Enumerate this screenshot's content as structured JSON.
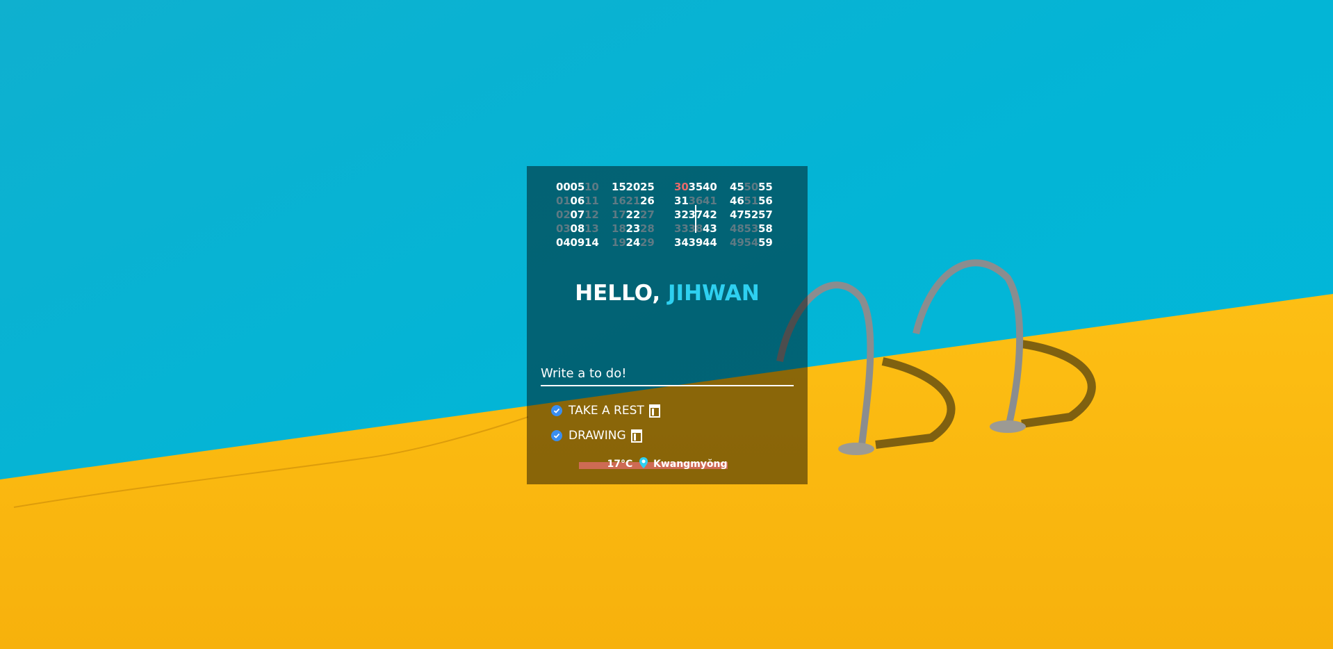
{
  "clock": {
    "columns": [
      [
        "00",
        "01",
        "02",
        "03",
        "04"
      ],
      [
        "05",
        "06",
        "07",
        "08",
        "09"
      ],
      [
        "10",
        "11",
        "12",
        "13",
        "14"
      ],
      [
        "15",
        "16",
        "17",
        "18",
        "19"
      ],
      [
        "20",
        "21",
        "22",
        "23",
        "24"
      ],
      [
        "25",
        "26",
        "27",
        "28",
        "29"
      ],
      [
        "30",
        "31",
        "32",
        "33",
        "34"
      ],
      [
        "35",
        "36",
        "37",
        "38",
        "39"
      ],
      [
        "40",
        "41",
        "42",
        "43",
        "44"
      ],
      [
        "45",
        "46",
        "47",
        "48",
        "49"
      ],
      [
        "50",
        "51",
        "52",
        "53",
        "54"
      ],
      [
        "55",
        "56",
        "57",
        "58",
        "59"
      ]
    ],
    "highlighted_current": "30"
  },
  "greeting": {
    "prefix": "HELLO,",
    "name": "JIHWAN"
  },
  "todo": {
    "placeholder": "Write a to do!",
    "items": [
      {
        "label": "TAKE A REST"
      },
      {
        "label": "DRAWING"
      }
    ]
  },
  "weather": {
    "temperature": "17°C",
    "location": "Kwangmyŏng"
  },
  "colors": {
    "pool_blue": "#03b5d6",
    "deck_yellow": "#fbb80e",
    "name_accent": "#2ed0f0",
    "current_minute": "#e86a6a",
    "check_blue": "#3a8ef0"
  }
}
